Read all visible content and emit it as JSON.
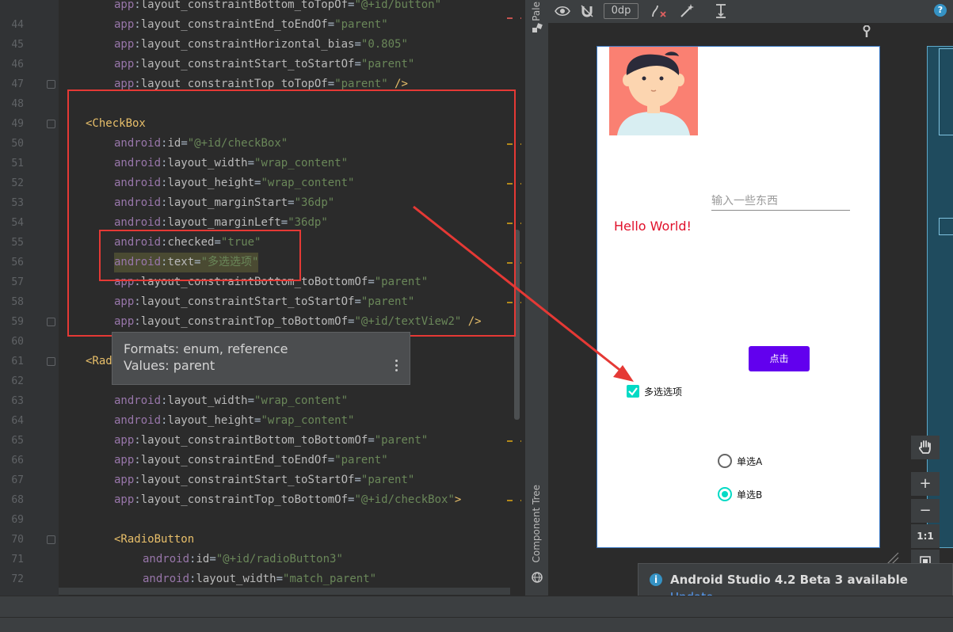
{
  "editor": {
    "lines": [
      {
        "n": "",
        "indent": 144,
        "parts": [
          [
            "ns",
            "app"
          ],
          [
            "colon",
            ":"
          ],
          [
            "attr",
            "layout_constraintBottom_toTopOf"
          ],
          [
            "eq",
            "="
          ],
          [
            "str",
            "\"@+id/button\""
          ]
        ]
      },
      {
        "n": "44",
        "indent": 144,
        "parts": [
          [
            "ns",
            "app"
          ],
          [
            "colon",
            ":"
          ],
          [
            "attr",
            "layout_constraintEnd_toEndOf"
          ],
          [
            "eq",
            "="
          ],
          [
            "str",
            "\"parent\""
          ]
        ]
      },
      {
        "n": "45",
        "indent": 144,
        "parts": [
          [
            "ns",
            "app"
          ],
          [
            "colon",
            ":"
          ],
          [
            "attr",
            "layout_constraintHorizontal_bias"
          ],
          [
            "eq",
            "="
          ],
          [
            "str",
            "\"0.805\""
          ]
        ]
      },
      {
        "n": "46",
        "indent": 144,
        "parts": [
          [
            "ns",
            "app"
          ],
          [
            "colon",
            ":"
          ],
          [
            "attr",
            "layout_constraintStart_toStartOf"
          ],
          [
            "eq",
            "="
          ],
          [
            "str",
            "\"parent\""
          ]
        ]
      },
      {
        "n": "47",
        "indent": 144,
        "parts": [
          [
            "ns",
            "app"
          ],
          [
            "colon",
            ":"
          ],
          [
            "attr",
            "layout_constraintTop_toTopOf"
          ],
          [
            "eq",
            "="
          ],
          [
            "str",
            "\"parent\""
          ],
          [
            "punct",
            " />"
          ]
        ]
      },
      {
        "n": "48",
        "indent": 144,
        "parts": []
      },
      {
        "n": "49",
        "indent": 108,
        "parts": [
          [
            "tag",
            "<CheckBox"
          ]
        ]
      },
      {
        "n": "50",
        "indent": 144,
        "parts": [
          [
            "ns",
            "android"
          ],
          [
            "colon",
            ":"
          ],
          [
            "attr",
            "id"
          ],
          [
            "eq",
            "="
          ],
          [
            "str",
            "\"@+id/checkBox\""
          ]
        ]
      },
      {
        "n": "51",
        "indent": 144,
        "parts": [
          [
            "ns",
            "android"
          ],
          [
            "colon",
            ":"
          ],
          [
            "attr",
            "layout_width"
          ],
          [
            "eq",
            "="
          ],
          [
            "str",
            "\"wrap_content\""
          ]
        ]
      },
      {
        "n": "52",
        "indent": 144,
        "parts": [
          [
            "ns",
            "android"
          ],
          [
            "colon",
            ":"
          ],
          [
            "attr",
            "layout_height"
          ],
          [
            "eq",
            "="
          ],
          [
            "str",
            "\"wrap_content\""
          ]
        ]
      },
      {
        "n": "53",
        "indent": 144,
        "parts": [
          [
            "ns",
            "android"
          ],
          [
            "colon",
            ":"
          ],
          [
            "attr",
            "layout_marginStart"
          ],
          [
            "eq",
            "="
          ],
          [
            "str",
            "\"36dp\""
          ]
        ]
      },
      {
        "n": "54",
        "indent": 144,
        "parts": [
          [
            "ns",
            "android"
          ],
          [
            "colon",
            ":"
          ],
          [
            "attr",
            "layout_marginLeft"
          ],
          [
            "eq",
            "="
          ],
          [
            "str",
            "\"36dp\""
          ]
        ]
      },
      {
        "n": "55",
        "indent": 144,
        "parts": [
          [
            "ns",
            "android"
          ],
          [
            "colon",
            ":"
          ],
          [
            "attr",
            "checked"
          ],
          [
            "eq",
            "="
          ],
          [
            "str",
            "\"true\""
          ]
        ]
      },
      {
        "n": "56",
        "indent": 144,
        "highlight": true,
        "parts": [
          [
            "ns",
            "android"
          ],
          [
            "colon",
            ":"
          ],
          [
            "attr",
            "text"
          ],
          [
            "eq",
            "="
          ],
          [
            "str",
            "\"多选选项\""
          ]
        ]
      },
      {
        "n": "57",
        "indent": 144,
        "parts": [
          [
            "ns",
            "app"
          ],
          [
            "colon",
            ":"
          ],
          [
            "attr",
            "layout_constraintBottom_toBottomOf"
          ],
          [
            "eq",
            "="
          ],
          [
            "str",
            "\"parent\""
          ]
        ]
      },
      {
        "n": "58",
        "indent": 144,
        "parts": [
          [
            "ns",
            "app"
          ],
          [
            "colon",
            ":"
          ],
          [
            "attr",
            "layout_constraintStart_toStartOf"
          ],
          [
            "eq",
            "="
          ],
          [
            "str",
            "\"parent\""
          ]
        ]
      },
      {
        "n": "59",
        "indent": 144,
        "parts": [
          [
            "ns",
            "app"
          ],
          [
            "colon",
            ":"
          ],
          [
            "attr",
            "layout_constraintTop_toBottomOf"
          ],
          [
            "eq",
            "="
          ],
          [
            "str",
            "\"@+id/textView2\""
          ],
          [
            "punct",
            " />"
          ]
        ]
      },
      {
        "n": "60",
        "indent": 144,
        "parts": []
      },
      {
        "n": "61",
        "indent": 108,
        "parts": [
          [
            "tag",
            "<Rad"
          ]
        ]
      },
      {
        "n": "62",
        "indent": 144,
        "parts": []
      },
      {
        "n": "63",
        "indent": 144,
        "parts": [
          [
            "ns",
            "android"
          ],
          [
            "colon",
            ":"
          ],
          [
            "attr",
            "layout_width"
          ],
          [
            "eq",
            "="
          ],
          [
            "str",
            "\"wrap_content\""
          ]
        ]
      },
      {
        "n": "64",
        "indent": 144,
        "parts": [
          [
            "ns",
            "android"
          ],
          [
            "colon",
            ":"
          ],
          [
            "attr",
            "layout_height"
          ],
          [
            "eq",
            "="
          ],
          [
            "str",
            "\"wrap_content\""
          ]
        ]
      },
      {
        "n": "65",
        "indent": 144,
        "parts": [
          [
            "ns",
            "app"
          ],
          [
            "colon",
            ":"
          ],
          [
            "attr",
            "layout_constraintBottom_toBottomOf"
          ],
          [
            "eq",
            "="
          ],
          [
            "str",
            "\"parent\""
          ]
        ]
      },
      {
        "n": "66",
        "indent": 144,
        "parts": [
          [
            "ns",
            "app"
          ],
          [
            "colon",
            ":"
          ],
          [
            "attr",
            "layout_constraintEnd_toEndOf"
          ],
          [
            "eq",
            "="
          ],
          [
            "str",
            "\"parent\""
          ]
        ]
      },
      {
        "n": "67",
        "indent": 144,
        "parts": [
          [
            "ns",
            "app"
          ],
          [
            "colon",
            ":"
          ],
          [
            "attr",
            "layout_constraintStart_toStartOf"
          ],
          [
            "eq",
            "="
          ],
          [
            "str",
            "\"parent\""
          ]
        ]
      },
      {
        "n": "68",
        "indent": 144,
        "parts": [
          [
            "ns",
            "app"
          ],
          [
            "colon",
            ":"
          ],
          [
            "attr",
            "layout_constraintTop_toBottomOf"
          ],
          [
            "eq",
            "="
          ],
          [
            "str",
            "\"@+id/checkBox\""
          ],
          [
            "punct",
            ">"
          ]
        ]
      },
      {
        "n": "69",
        "indent": 144,
        "parts": []
      },
      {
        "n": "70",
        "indent": 144,
        "parts": [
          [
            "tag",
            "<RadioButton"
          ]
        ]
      },
      {
        "n": "71",
        "indent": 180,
        "parts": [
          [
            "ns",
            "android"
          ],
          [
            "colon",
            ":"
          ],
          [
            "attr",
            "id"
          ],
          [
            "eq",
            "="
          ],
          [
            "str",
            "\"@+id/radioButton3\""
          ]
        ]
      },
      {
        "n": "72",
        "indent": 180,
        "parts": [
          [
            "ns",
            "android"
          ],
          [
            "colon",
            ":"
          ],
          [
            "attr",
            "layout_width"
          ],
          [
            "eq",
            "="
          ],
          [
            "str",
            "\"match_parent\""
          ]
        ]
      }
    ]
  },
  "tooltip": {
    "line1": "Formats: enum, reference",
    "line2": "Values: parent"
  },
  "side_tabs": {
    "palette": "Pale",
    "component_tree": "Component Tree"
  },
  "design_toolbar": {
    "dp_value": "0dp",
    "help": "?"
  },
  "preview": {
    "hello_text": "Hello World!",
    "edit_hint": "输入一些东西",
    "button_label": "点击",
    "checkbox_label": "多选选项",
    "checkbox_checked": true,
    "radio_a_label": "单选A",
    "radio_b_label": "单选B",
    "radio_selected": "B",
    "accent_color": "#03dac5",
    "button_color": "#6200ee",
    "hello_color": "#e0102a"
  },
  "zoom": {
    "plus": "+",
    "minus": "−",
    "one_to_one": "1:1"
  },
  "notification": {
    "title": "Android Studio 4.2 Beta 3 available",
    "link": "Update..."
  }
}
